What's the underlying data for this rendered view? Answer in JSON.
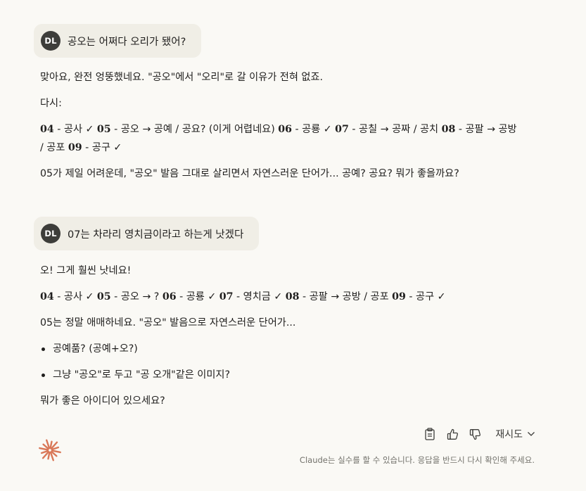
{
  "conversation": {
    "msg1": {
      "avatar": "DL",
      "text": "공오는 어쩌다 오리가 됐어?"
    },
    "resp1": {
      "line1": "맞아요, 완전 엉뚱했네요. \"공오\"에서 \"오리\"로 갈 이유가 전혀 없죠.",
      "line2": "다시:",
      "list_a": [
        {
          "num": "04",
          "text": " - 공사 ✓ "
        },
        {
          "num": "05",
          "text": " - 공오 → 공예 / 공요? (이게 어렵네요) "
        },
        {
          "num": "06",
          "text": " - 공룡 ✓ "
        },
        {
          "num": "07",
          "text": " - 공칠 → 공짜 / 공치 "
        },
        {
          "num": "08",
          "text": " - 공팔 → 공방"
        }
      ],
      "list_b": [
        {
          "text": "/ 공포 "
        },
        {
          "num": "09",
          "text": " - 공구 ✓"
        }
      ],
      "line4": "05가 제일 어려운데, \"공오\" 발음 그대로 살리면서 자연스러운 단어가... 공예? 공요? 뭐가 좋을까요?"
    },
    "msg2": {
      "avatar": "DL",
      "text": "07는 차라리 영치금이라고 하는게 낫겠다"
    },
    "resp2": {
      "line1": "오! 그게 훨씬 낫네요!",
      "list": [
        {
          "num": "04",
          "text": " - 공사 ✓ "
        },
        {
          "num": "05",
          "text": " - 공오 → ? "
        },
        {
          "num": "06",
          "text": " - 공룡 ✓ "
        },
        {
          "num": "07",
          "text": " - 영치금 ✓ "
        },
        {
          "num": "08",
          "text": " - 공팔 → 공방 / 공포 "
        },
        {
          "num": "09",
          "text": " - 공구 ✓"
        }
      ],
      "line3": "05는 정말 애매하네요. \"공오\" 발음으로 자연스러운 단어가...",
      "bullets": [
        "공예품? (공예+오?)",
        "그냥 \"공오\"로 두고 \"공 오개\"같은 이미지?"
      ],
      "line5": "뭐가 좋은 아이디어 있으세요?"
    }
  },
  "actions": {
    "copy_icon": "clipboard-icon",
    "like_icon": "thumbs-up-icon",
    "dislike_icon": "thumbs-down-icon",
    "retry_label": "재시도"
  },
  "footer": {
    "disclaimer": "Claude는 실수를 할 수 있습니다. 응답을 반드시 다시 확인해 주세요."
  },
  "colors": {
    "background": "#faf9f5",
    "bubble": "#f0eee6",
    "avatar": "#3d3d3a",
    "brand": "#d97757"
  }
}
